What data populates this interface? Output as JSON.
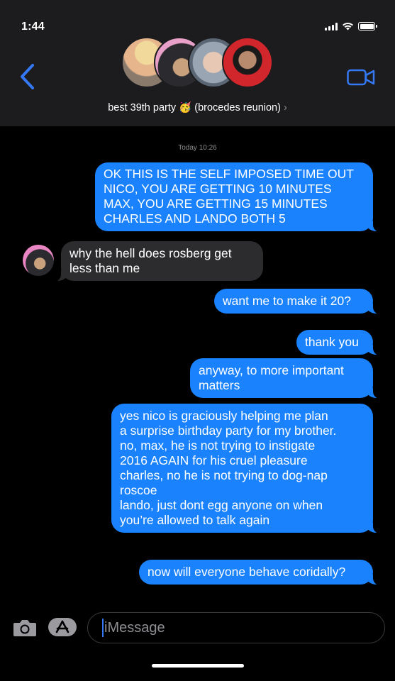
{
  "status_bar": {
    "time": "1:44"
  },
  "header": {
    "group_name": "best 39th party 🥳 (brocedes reunion)",
    "chevron": "›",
    "back_icon": "chevron-left-icon",
    "video_icon": "video-camera-icon"
  },
  "conversation": {
    "timestamp": "Today 10:26",
    "messages": [
      {
        "direction": "outgoing",
        "text": "OK THIS IS THE SELF IMPOSED TIME OUT\nNICO, YOU ARE GETTING 10 MINUTES\nMAX, YOU ARE GETTING 15 MINUTES\nCHARLES AND LANDO BOTH 5"
      },
      {
        "direction": "incoming",
        "text": "why the hell does rosberg get\nless than me"
      },
      {
        "direction": "outgoing",
        "text": "want me to make it 20?"
      },
      {
        "direction": "outgoing",
        "text": "thank you"
      },
      {
        "direction": "outgoing",
        "text": "anyway, to more important\nmatters"
      },
      {
        "direction": "outgoing",
        "text": "yes nico is graciously helping me plan\na surprise birthday party for my brother.\nno, max, he is not trying to instigate\n2016 AGAIN for his cruel pleasure\ncharles, no he is not trying to dog-nap\nroscoe\nlando, just dont egg anyone on when\nyou’re allowed to talk again"
      },
      {
        "direction": "outgoing",
        "text": "now will everyone behave coridally?"
      }
    ]
  },
  "composer": {
    "placeholder": "iMessage",
    "camera_icon": "camera-icon",
    "apps_icon": "app-store-icon"
  },
  "colors": {
    "outgoing_bubble": "#1982fc",
    "incoming_bubble": "#2c2c2e",
    "header_bg": "#1c1c1e",
    "accent": "#3478f6"
  }
}
